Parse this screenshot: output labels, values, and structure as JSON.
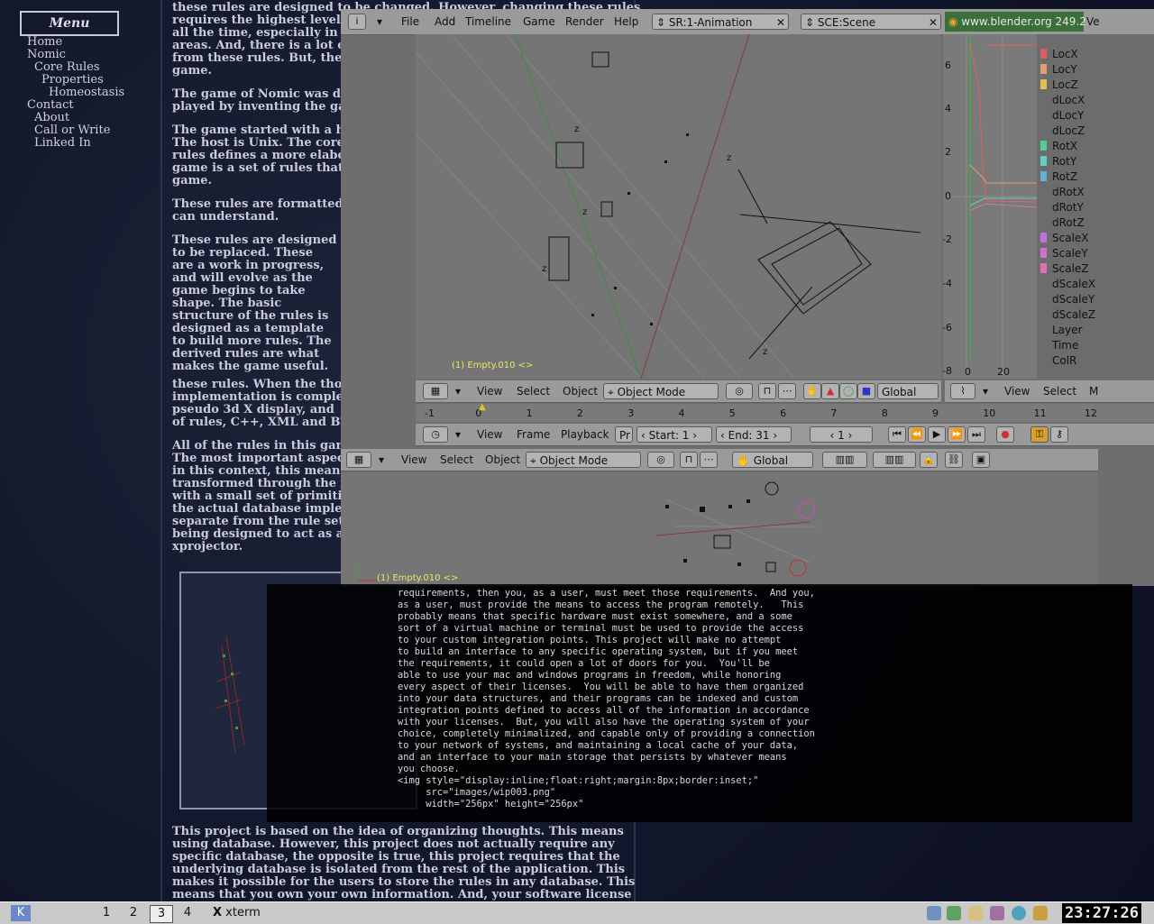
{
  "webpage": {
    "menu_title": "Menu",
    "nav": [
      "Home",
      "Nomic",
      "Core Rules",
      "Properties",
      "Homeostasis",
      "Contact",
      "About",
      "Call or Write",
      "Linked In"
    ],
    "paragraphs": [
      "these rules are designed to be changed. However, changing these rules\nrequires the highest level o\nall the time, especially in t\nareas. And, there is a lot of\nfrom these rules. But, they\ngame.",
      "The game of Nomic was de\nplayed by inventing the ga",
      "The game started with a ho\nThe host is Unix. The core\nrules defines a more elabo\ngame is a set of rules that\ngame.",
      "These rules are formatted\ncan understand.",
      "These rules are designed\nto be replaced. These\nare a work in progress,\nand will evolve as the\ngame begins to take\nshape. The basic\nstructure of the rules is\ndesigned as a template\nto build more rules. The\nderived rules are what\nmakes the game useful.",
      "these rules. When the thou\nimplementation is complet\npseudo 3d X display, and\nof rules, C++, XML and BT",
      "All of the rules in this gam\nThe most important aspect\nin this context, this means\ntransformed through the x\nwith a small set of primitiv\nthe actual database implem\nseparate from the rule set.\nbeing designed to act as a\nxprojector.",
      "This project is based on the idea of organizing thoughts. This means\nusing database. However, this project does not actually require any\nspecific database, the opposite is true, this project requires that the\nunderlying database is isolated from the rest of the application. This\nmakes it possible for the users to store the rules in any database. This\nmeans that you own your own information. And, your software license"
    ]
  },
  "blender": {
    "top_menu": [
      "File",
      "Add",
      "Timeline",
      "Game",
      "Render",
      "Help"
    ],
    "screen_name": "SR:1-Animation",
    "scene_name": "SCE:Scene",
    "url": "www.blender.org 249.2",
    "version_tail": "Ve",
    "viewport_top": {
      "object_label": "(1) Empty.010 <>",
      "menu": [
        "View",
        "Select",
        "Object"
      ],
      "mode": "Object Mode",
      "orientation": "Global"
    },
    "ipo": {
      "y_ticks": [
        "6",
        "4",
        "2",
        "0",
        "-2",
        "-4",
        "-6",
        "-8"
      ],
      "x_ticks": [
        "0",
        "20"
      ],
      "channels": [
        {
          "name": "LocX",
          "color": "#d86060"
        },
        {
          "name": "LocY",
          "color": "#e0a070"
        },
        {
          "name": "LocZ",
          "color": "#e0c050"
        },
        {
          "name": "dLocX",
          "color": ""
        },
        {
          "name": "dLocY",
          "color": ""
        },
        {
          "name": "dLocZ",
          "color": ""
        },
        {
          "name": "RotX",
          "color": "#50d090"
        },
        {
          "name": "RotY",
          "color": "#60d0c0"
        },
        {
          "name": "RotZ",
          "color": "#60b0d8"
        },
        {
          "name": "dRotX",
          "color": ""
        },
        {
          "name": "dRotY",
          "color": ""
        },
        {
          "name": "dRotZ",
          "color": ""
        },
        {
          "name": "ScaleX",
          "color": "#c070e0"
        },
        {
          "name": "ScaleY",
          "color": "#d070d0"
        },
        {
          "name": "ScaleZ",
          "color": "#e070b0"
        },
        {
          "name": "dScaleX",
          "color": ""
        },
        {
          "name": "dScaleY",
          "color": ""
        },
        {
          "name": "dScaleZ",
          "color": ""
        },
        {
          "name": "Layer",
          "color": ""
        },
        {
          "name": "Time",
          "color": ""
        },
        {
          "name": "ColR",
          "color": ""
        }
      ],
      "menu": [
        "View",
        "Select",
        "M"
      ]
    },
    "timeline": {
      "ruler": [
        "-1",
        "0",
        "1",
        "2",
        "3",
        "4",
        "5",
        "6",
        "7",
        "8",
        "9",
        "10",
        "11",
        "12"
      ],
      "menu": [
        "View",
        "Frame",
        "Playback",
        "Pr"
      ],
      "start": "Start: 1",
      "end": "End: 31",
      "current": "1"
    },
    "viewport_bottom": {
      "menu": [
        "View",
        "Select",
        "Object"
      ],
      "mode": "Object Mode",
      "orientation": "Global",
      "object_label": "(1) Empty.010 <>"
    }
  },
  "xterm": {
    "lines": [
      "requirements, then you, as a user, must meet those requirements.  And you,",
      "as a user, must provide the means to access the program remotely.   This",
      "probably means that specific hardware must exist somewhere, and a some",
      "sort of a virtual machine or terminal must be used to provide the access",
      "to your custom integration points. This project will make no attempt",
      "to build an interface to any specific operating system, but if you meet",
      "the requirements, it could open a lot of doors for you.  You'll be",
      "able to use your mac and windows programs in freedom, while honoring",
      "every aspect of their licenses.  You will be able to have them organized",
      "into your data structures, and their programs can be indexed and custom",
      "integration points defined to access all of the information in accordance",
      "with your licenses.  But, you will also have the operating system of your",
      "choice, completely minimalized, and capable only of providing a connection",
      "to your network of systems, and maintaining a local cache of your data,",
      "and an interface to your main storage that persists by whatever means",
      "you choose.",
      "<img style=\"display:inline;float:right;margin:8px;border:inset;\"",
      "     src=\"images/wip003.png\"",
      "     width=\"256px\" height=\"256px\""
    ]
  },
  "taskbar": {
    "desktops": [
      "1",
      "2",
      "3",
      "4"
    ],
    "task": "xterm",
    "clock": "23:27:26"
  }
}
